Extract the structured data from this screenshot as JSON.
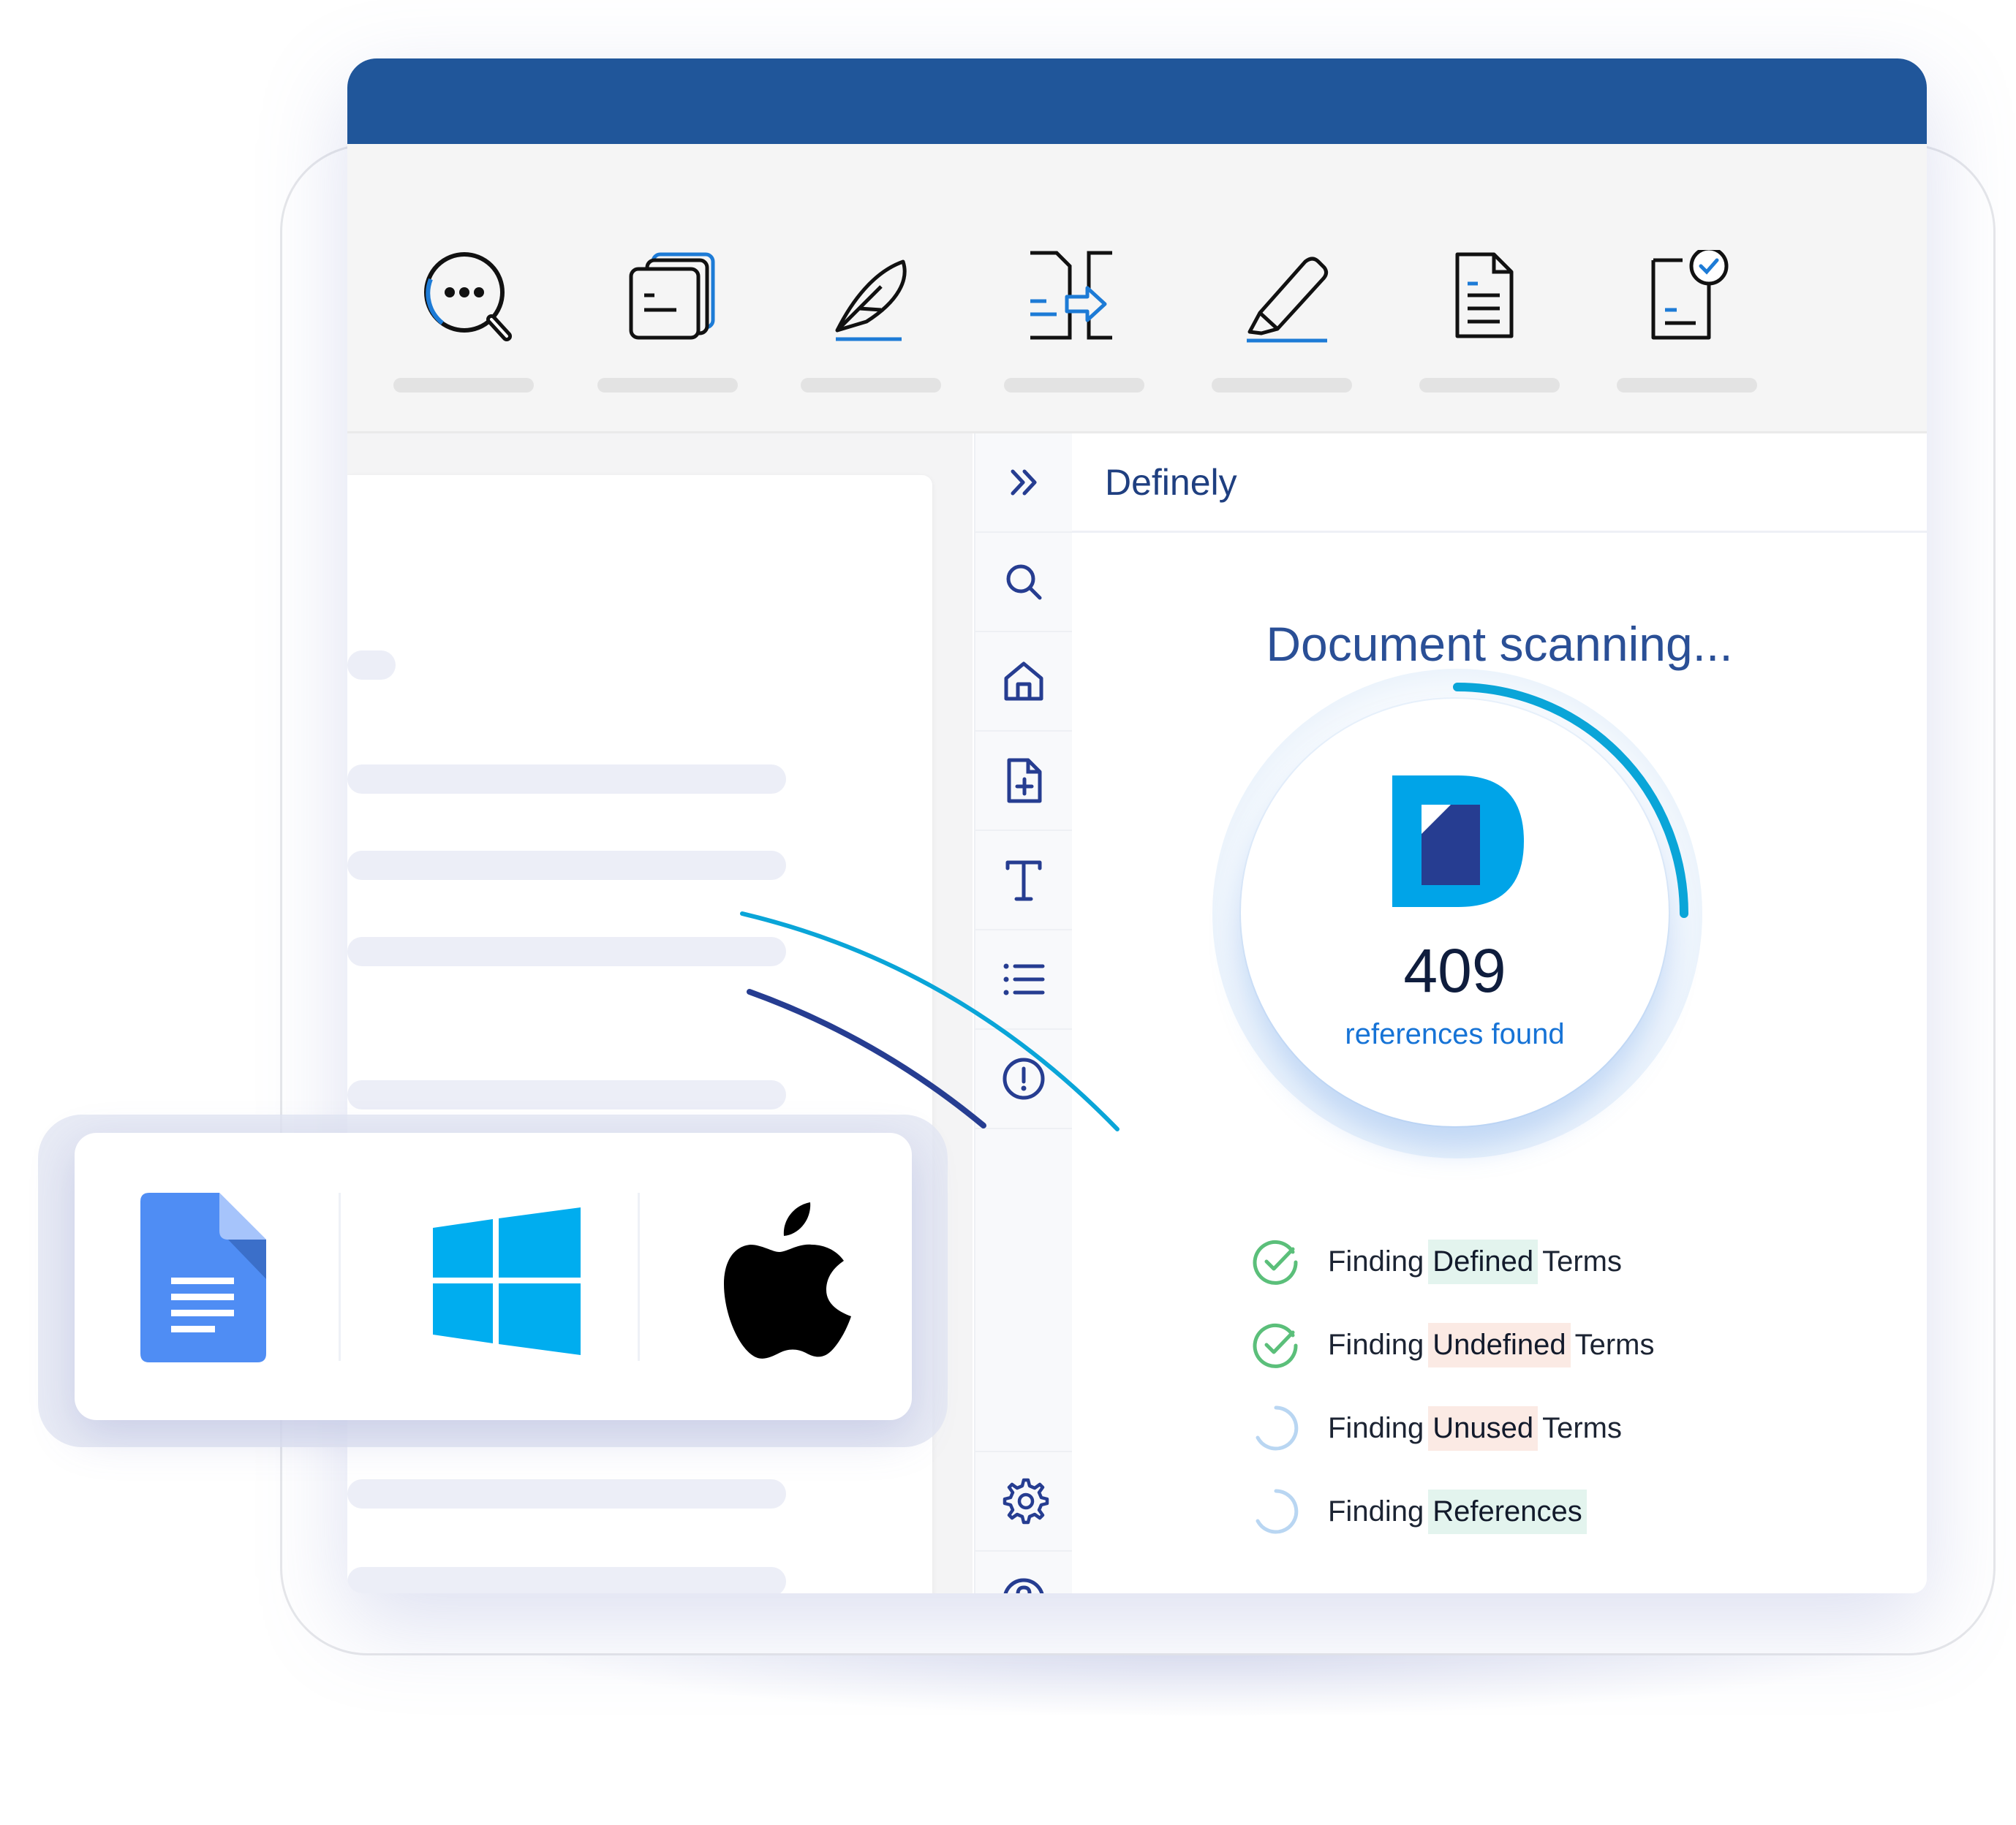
{
  "ribbon": {
    "tools": [
      {
        "icon": "search-dots-icon"
      },
      {
        "icon": "stacked-documents-icon"
      },
      {
        "icon": "feather-pen-icon"
      },
      {
        "icon": "document-transfer-icon"
      },
      {
        "icon": "highlighter-icon"
      },
      {
        "icon": "document-text-icon"
      },
      {
        "icon": "document-check-icon"
      }
    ]
  },
  "sidebar": {
    "items": [
      {
        "icon": "chevron-double-right-icon"
      },
      {
        "icon": "search-icon"
      },
      {
        "icon": "home-icon"
      },
      {
        "icon": "add-document-icon"
      },
      {
        "icon": "text-icon"
      },
      {
        "icon": "list-icon"
      },
      {
        "icon": "alert-icon"
      },
      {
        "icon": "gear-icon"
      },
      {
        "icon": "help-icon"
      }
    ]
  },
  "panel": {
    "title": "Definely",
    "scan_title": "Document scanning...",
    "progress": 0.25,
    "count": "409",
    "count_label": "references found",
    "tasks": [
      {
        "prefix": "Finding",
        "keyword": "Defined",
        "suffix": "Terms",
        "status": "done",
        "highlight": "green"
      },
      {
        "prefix": "Finding",
        "keyword": "Undefined",
        "suffix": "Terms",
        "status": "done",
        "highlight": "peach"
      },
      {
        "prefix": "Finding",
        "keyword": "Unused",
        "suffix": "Terms",
        "status": "loading",
        "highlight": "peach"
      },
      {
        "prefix": "Finding",
        "keyword": "References",
        "suffix": "",
        "status": "loading",
        "highlight": "green"
      }
    ]
  },
  "platforms": [
    {
      "icon": "google-docs-icon"
    },
    {
      "icon": "windows-logo-icon"
    },
    {
      "icon": "apple-logo-icon"
    }
  ],
  "colors": {
    "titlebar": "#20569a",
    "accent": "#00a3dc",
    "navy": "#263d91",
    "check": "#5bbf7a"
  }
}
